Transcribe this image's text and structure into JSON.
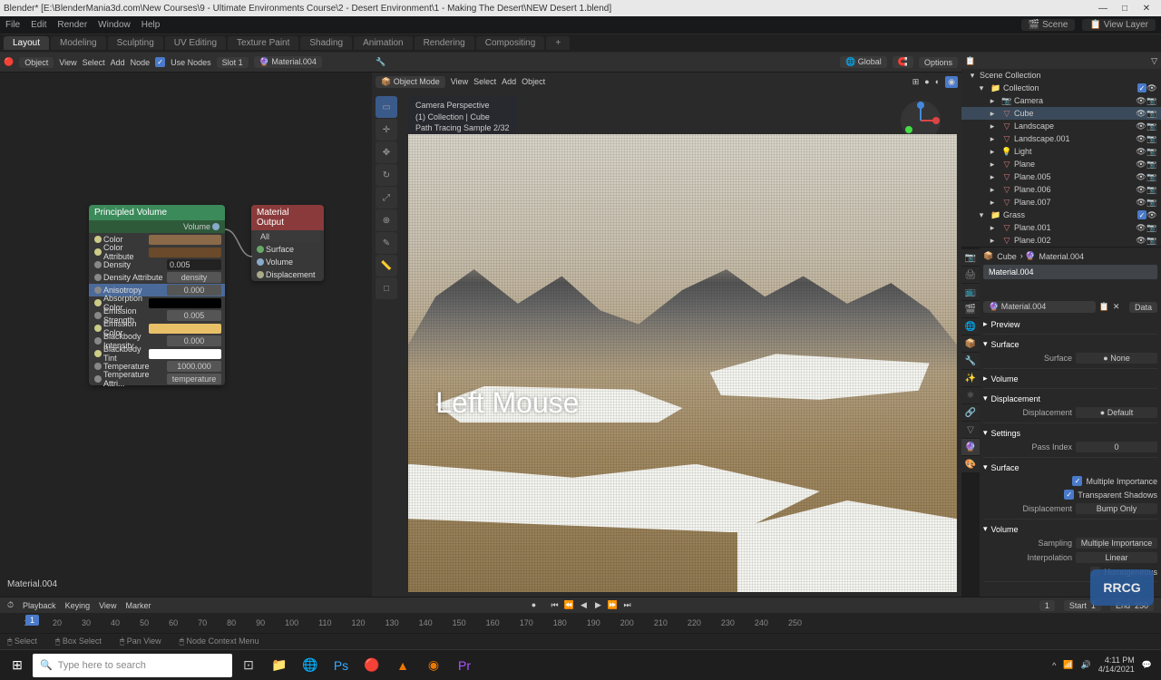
{
  "titlebar": {
    "app": "Blender*",
    "path": "[E:\\BlenderMania3d.com\\New Courses\\9 - Ultimate Environments Course\\2 - Desert Environment\\1 - Making The Desert\\NEW Desert 1.blend]"
  },
  "menubar": {
    "items": [
      "File",
      "Edit",
      "Render",
      "Window",
      "Help"
    ],
    "scene": "Scene",
    "viewlayer": "View Layer"
  },
  "tabs": [
    "Layout",
    "Modeling",
    "Sculpting",
    "UV Editing",
    "Texture Paint",
    "Shading",
    "Animation",
    "Rendering",
    "Compositing"
  ],
  "active_tab": "Layout",
  "node_editor": {
    "toolbar": {
      "object": "Object",
      "view": "View",
      "select": "Select",
      "add": "Add",
      "node": "Node",
      "use_nodes": "Use Nodes",
      "slot": "Slot 1",
      "material": "Material.004"
    },
    "principled_volume": {
      "title": "Principled Volume",
      "output": "Volume",
      "rows": [
        {
          "label": "Color",
          "swatch": "#8a6a48"
        },
        {
          "label": "Color Attribute",
          "swatch": "#6a4a2a"
        },
        {
          "label": "Density",
          "value": "0.005",
          "editing": true
        },
        {
          "label": "Density Attribute",
          "value": "density"
        },
        {
          "label": "Anisotropy",
          "value": "0.000",
          "hl": true
        },
        {
          "label": "Absorption Color",
          "swatch": "#000000"
        },
        {
          "label": "Emission Strength",
          "value": "0.005"
        },
        {
          "label": "Emission Color",
          "swatch": "#e8c068"
        },
        {
          "label": "Blackbody Intensity",
          "value": "0.000"
        },
        {
          "label": "Blackbody Tint",
          "swatch": "#ffffff"
        },
        {
          "label": "Temperature",
          "value": "1000.000"
        },
        {
          "label": "Temperature Attri...",
          "value": "temperature"
        }
      ]
    },
    "material_output": {
      "title": "Material Output",
      "target": "All",
      "inputs": [
        "Surface",
        "Volume",
        "Displacement"
      ]
    },
    "bottom_label": "Material.004"
  },
  "viewport": {
    "mode": "Object Mode",
    "menus": [
      "View",
      "Select",
      "Add",
      "Object"
    ],
    "orient": "Global",
    "options": "Options",
    "info": {
      "l1": "Camera Perspective",
      "l2": "(1) Collection | Cube",
      "l3": "Path Tracing Sample 2/32"
    },
    "overlay_text": "Left Mouse"
  },
  "outliner": {
    "title": "Scene Collection",
    "collection": "Collection",
    "items": [
      {
        "name": "Camera",
        "icon": "📷"
      },
      {
        "name": "Cube",
        "icon": "▽",
        "sel": true
      },
      {
        "name": "Landscape",
        "icon": "▽"
      },
      {
        "name": "Landscape.001",
        "icon": "▽"
      },
      {
        "name": "Light",
        "icon": "💡"
      },
      {
        "name": "Plane",
        "icon": "▽"
      },
      {
        "name": "Plane.005",
        "icon": "▽"
      },
      {
        "name": "Plane.006",
        "icon": "▽"
      },
      {
        "name": "Plane.007",
        "icon": "▽"
      }
    ],
    "grass": "Grass",
    "grass_items": [
      {
        "name": "Plane.001",
        "icon": "▽"
      },
      {
        "name": "Plane.002",
        "icon": "▽"
      }
    ]
  },
  "properties": {
    "breadcrumb_obj": "Cube",
    "breadcrumb_mat": "Material.004",
    "slot": "Material.004",
    "mat_name": "Material.004",
    "data": "Data",
    "sections": {
      "preview": "Preview",
      "surface": "Surface",
      "surface_val": "None",
      "volume": "Volume",
      "displacement": "Displacement",
      "displacement_val": "Default",
      "settings": "Settings",
      "pass_index": "Pass Index",
      "pass_index_val": "0",
      "multi_importance": "Multiple Importance",
      "transparent_shadows": "Transparent Shadows",
      "disp_method": "Displacement",
      "disp_method_val": "Bump Only",
      "volume_sec": "Volume",
      "sampling": "Sampling",
      "sampling_val": "Multiple Importance",
      "interpolation": "Interpolation",
      "interpolation_val": "Linear",
      "homogeneous": "Homogeneous"
    }
  },
  "timeline": {
    "playback": "Playback",
    "keying": "Keying",
    "view": "View",
    "marker": "Marker",
    "current": "1",
    "ticks": [
      "10",
      "20",
      "30",
      "40",
      "50",
      "60",
      "70",
      "80",
      "90",
      "100",
      "110",
      "120",
      "130",
      "140",
      "150",
      "160",
      "170",
      "180",
      "190",
      "200",
      "210",
      "220",
      "230",
      "240",
      "250"
    ],
    "start_lbl": "Start",
    "start": "1",
    "end_lbl": "End",
    "end": "250",
    "frame": "1"
  },
  "statusbar": {
    "select": "Select",
    "box": "Box Select",
    "pan": "Pan View",
    "ctx": "Node Context Menu"
  },
  "taskbar": {
    "search_placeholder": "Type here to search",
    "time": "4:11 PM",
    "date": "4/14/2021"
  },
  "watermark": "RRCG"
}
